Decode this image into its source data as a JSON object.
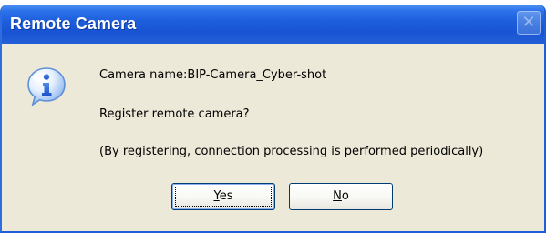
{
  "window": {
    "title": "Remote Camera",
    "close_label": "✕"
  },
  "icon": {
    "semantic": "info-icon"
  },
  "message": {
    "line1": "Camera name:BIP-Camera_Cyber-shot",
    "line2": "Register remote camera?",
    "line3": "(By registering, connection processing is performed periodically)"
  },
  "buttons": {
    "yes": {
      "accelerator": "Y",
      "rest": "es"
    },
    "no": {
      "accelerator": "N",
      "rest": "o"
    }
  },
  "colors": {
    "titlebar": "#1e5fdc",
    "dialog_background": "#ece9d8",
    "button_border": "#003c74"
  }
}
